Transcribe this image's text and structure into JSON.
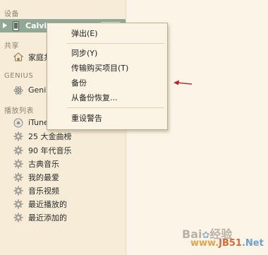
{
  "sidebar": {
    "sections": {
      "devices": "设备",
      "shared": "共享",
      "genius": "GENIUS",
      "playlists": "播放列表"
    },
    "device": {
      "label": "Calvin",
      "icon": "iphone-icon"
    },
    "shared_items": [
      {
        "label": "家庭共享",
        "icon": "home-icon"
      }
    ],
    "genius_items": [
      {
        "label": "Genius",
        "icon": "genius-atom-icon"
      }
    ],
    "playlist_items": [
      {
        "label": "iTunes DJ",
        "icon": "itunes-dj-icon"
      },
      {
        "label": "25 大金曲榜",
        "icon": "gear-icon"
      },
      {
        "label": "90 年代音乐",
        "icon": "gear-icon"
      },
      {
        "label": "古典音乐",
        "icon": "gear-icon"
      },
      {
        "label": "我的最爱",
        "icon": "gear-icon"
      },
      {
        "label": "音乐视频",
        "icon": "gear-icon"
      },
      {
        "label": "最近播放的",
        "icon": "gear-icon"
      },
      {
        "label": "最近添加的",
        "icon": "gear-icon"
      }
    ]
  },
  "context_menu": {
    "items": [
      {
        "label": "弹出(E)"
      },
      {
        "label": "同步(Y)"
      },
      {
        "label": "传输购买项目(T)"
      },
      {
        "label": "备份"
      },
      {
        "label": "从备份恢复..."
      },
      {
        "label": "重设警告"
      }
    ]
  },
  "watermark": {
    "line1": "Bai",
    "line1b": "经验",
    "line2a": "www.",
    "line2b": "JB51",
    "line2c": ".Net"
  },
  "colors": {
    "sidebar_bg": "#f6ecd8",
    "selection": "#91a894",
    "arrow": "#b0282c"
  }
}
